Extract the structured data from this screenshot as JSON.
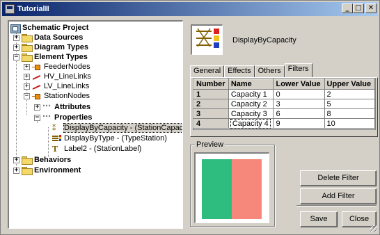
{
  "window": {
    "title": "TutorialII",
    "minimize_glyph": "_",
    "maximize_glyph": "□",
    "close_glyph": "✕"
  },
  "tree": {
    "root": "Schematic Project",
    "data_sources": "Data Sources",
    "diagram_types": "Diagram Types",
    "element_types": "Element Types",
    "feeder_nodes": "FeederNodes",
    "hv_linelinks": "HV_LineLinks",
    "lv_linelinks": "LV_LineLinks",
    "station_nodes": "StationNodes",
    "attributes": "Attributes",
    "properties": "Properties",
    "display_by_capacity": "DisplayByCapacity - (StationCapacity)",
    "display_by_type": "DisplayByType - (TypeStation)",
    "label2": "Label2 - (StationLabel)",
    "behaviors": "Behaviors",
    "environment": "Environment",
    "plus_glyph": "+",
    "minus_glyph": "−",
    "cap_icon_glyph": "⁑",
    "label_icon_glyph": "T"
  },
  "header": {
    "title": "DisplayByCapacity"
  },
  "tabs": [
    "General",
    "Effects",
    "Others",
    "Filters"
  ],
  "filters_table": {
    "columns": [
      "Number",
      "Name",
      "Lower Value",
      "Upper Value"
    ],
    "rows": [
      {
        "number": "1",
        "name": "Capacity 1",
        "lower": "0",
        "upper": "2"
      },
      {
        "number": "2",
        "name": "Capacity 2",
        "lower": "3",
        "upper": "5"
      },
      {
        "number": "3",
        "name": "Capacity 3",
        "lower": "6",
        "upper": "8"
      },
      {
        "number": "4",
        "name": "Capacity 4",
        "lower": "9",
        "upper": "10"
      }
    ]
  },
  "preview": {
    "label": "Preview",
    "colors": [
      "#2ebd7f",
      "#f5887a"
    ]
  },
  "buttons": {
    "delete_filter": "Delete Filter",
    "add_filter": "Add Filter",
    "save": "Save",
    "close": "Close"
  }
}
